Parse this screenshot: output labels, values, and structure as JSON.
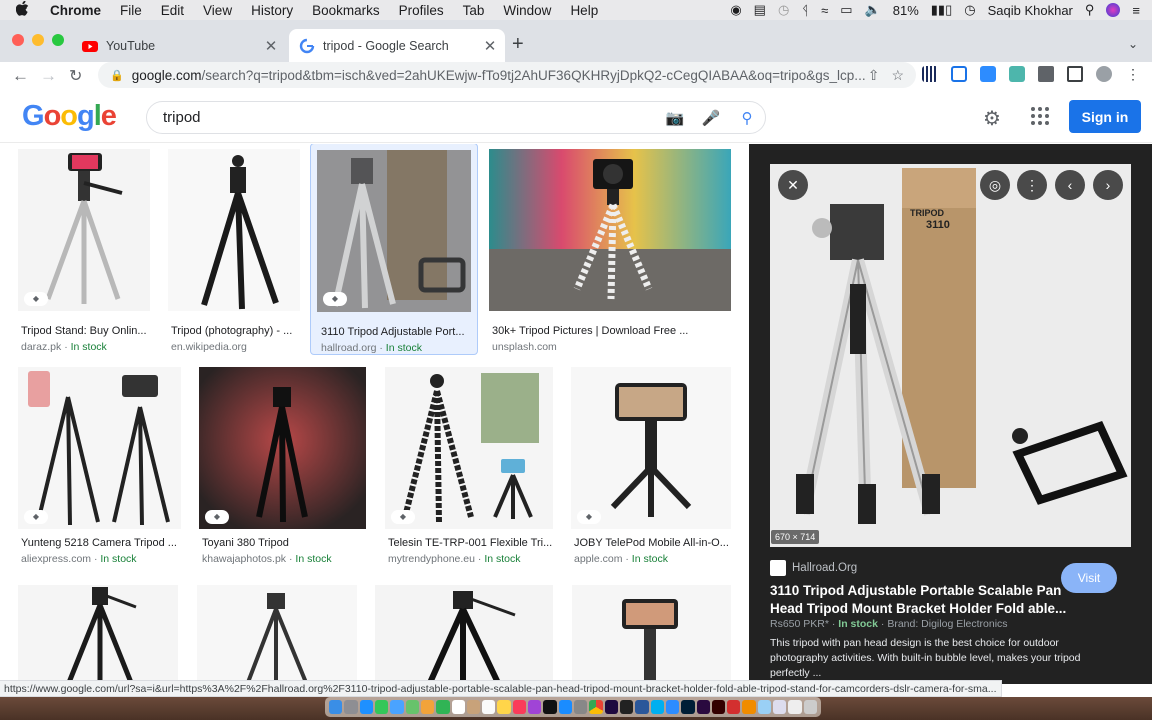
{
  "menubar": {
    "app": "Chrome",
    "items": [
      "File",
      "Edit",
      "View",
      "History",
      "Bookmarks",
      "Profiles",
      "Tab",
      "Window",
      "Help"
    ],
    "battery": "81%",
    "user": "Saqib Khokhar"
  },
  "tabs": [
    {
      "title": "YouTube"
    },
    {
      "title": "tripod - Google Search"
    }
  ],
  "omnibox": {
    "domain": "google.com",
    "path": "/search?q=tripod&tbm=isch&ved=2ahUKEwjw-fTo9tj2AhUF36QKHRyjDpkQ2-cCegQIABAA&oq=tripo&gs_lcp..."
  },
  "search": {
    "query": "tripod",
    "signin_label": "Sign in"
  },
  "results": [
    {
      "caption": "Tripod Stand: Buy Onlin...",
      "source": "daraz.pk",
      "stock": "In stock"
    },
    {
      "caption": "Tripod (photography) - ...",
      "source": "en.wikipedia.org",
      "stock": ""
    },
    {
      "caption": "3110 Tripod Adjustable Port...",
      "source": "hallroad.org",
      "stock": "In stock"
    },
    {
      "caption": "30k+ Tripod Pictures | Download Free ...",
      "source": "unsplash.com",
      "stock": ""
    },
    {
      "caption": "Yunteng 5218 Camera Tripod ...",
      "source": "aliexpress.com",
      "stock": "In stock"
    },
    {
      "caption": "Toyani 380 Tripod",
      "source": "khawajaphotos.pk",
      "stock": "In stock"
    },
    {
      "caption": "Telesin TE-TRP-001 Flexible Tri...",
      "source": "mytrendyphone.eu",
      "stock": "In stock"
    },
    {
      "caption": "JOBY TelePod Mobile All-in-O...",
      "source": "apple.com",
      "stock": "In stock"
    }
  ],
  "preview": {
    "dims": "670 × 714",
    "box_text": "TRIPOD 3110",
    "site": "Hallroad.Org",
    "visit_label": "Visit",
    "title": "3110 Tripod Adjustable Portable Scalable Pan Head Tripod Mount Bracket Holder Fold able...",
    "price": "Rs650 PKR*",
    "stock": "In stock",
    "brand": "Brand: Digilog Electronics",
    "description": "This tripod with pan head design is the best choice for outdoor photography activities. With built-in bubble level, makes your tripod perfectly ..."
  },
  "statusbar": "https://www.google.com/url?sa=i&url=https%3A%2F%2Fhallroad.org%2F3110-tripod-adjustable-portable-scalable-pan-head-tripod-mount-bracket-holder-fold-able-tripod-stand-for-camcorders-dslr-camera-for-sma..."
}
